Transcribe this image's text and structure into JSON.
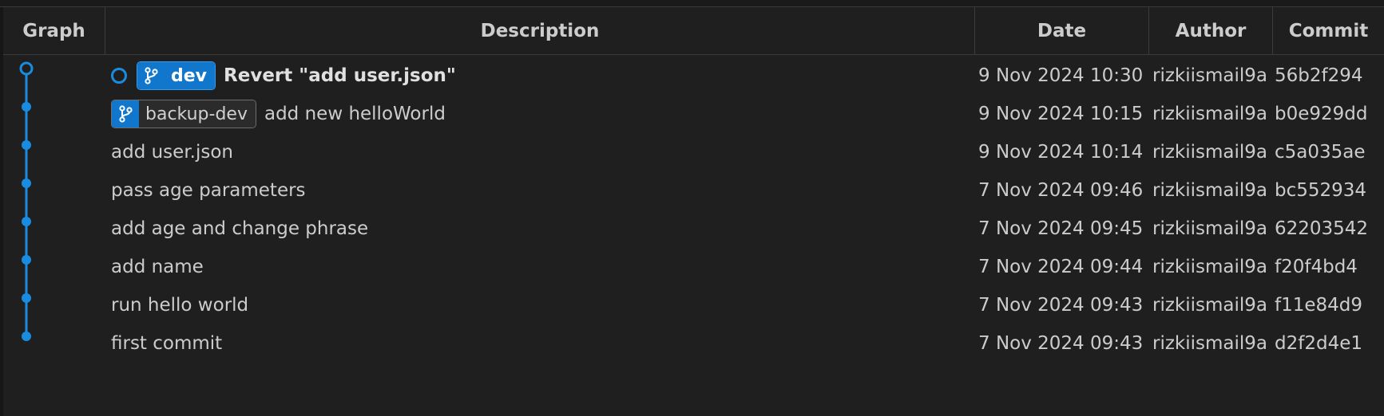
{
  "columns": {
    "graph": "Graph",
    "description": "Description",
    "date": "Date",
    "author": "Author",
    "commit": "Commit"
  },
  "colors": {
    "graph_line": "#1a8ce0",
    "branch_active": "#1177cc"
  },
  "commits": [
    {
      "refs": [
        {
          "name": "dev",
          "icon": "git-branch-icon",
          "current": true
        }
      ],
      "head": true,
      "message": "Revert \"add user.json\"",
      "date": "9 Nov 2024 10:30",
      "author": "rizkiismail9a",
      "hash": "56b2f294"
    },
    {
      "refs": [
        {
          "name": "backup-dev",
          "icon": "git-branch-icon",
          "current": false
        }
      ],
      "message": "add new helloWorld",
      "date": "9 Nov 2024 10:15",
      "author": "rizkiismail9a",
      "hash": "b0e929dd"
    },
    {
      "message": "add user.json",
      "date": "9 Nov 2024 10:14",
      "author": "rizkiismail9a",
      "hash": "c5a035ae"
    },
    {
      "message": "pass age parameters",
      "date": "7 Nov 2024 09:46",
      "author": "rizkiismail9a",
      "hash": "bc552934"
    },
    {
      "message": "add age and change phrase",
      "date": "7 Nov 2024 09:45",
      "author": "rizkiismail9a",
      "hash": "62203542"
    },
    {
      "message": "add name",
      "date": "7 Nov 2024 09:44",
      "author": "rizkiismail9a",
      "hash": "f20f4bd4"
    },
    {
      "message": "run hello world",
      "date": "7 Nov 2024 09:43",
      "author": "rizkiismail9a",
      "hash": "f11e84d9"
    },
    {
      "message": "first commit",
      "date": "7 Nov 2024 09:43",
      "author": "rizkiismail9a",
      "hash": "d2f2d4e1"
    }
  ]
}
